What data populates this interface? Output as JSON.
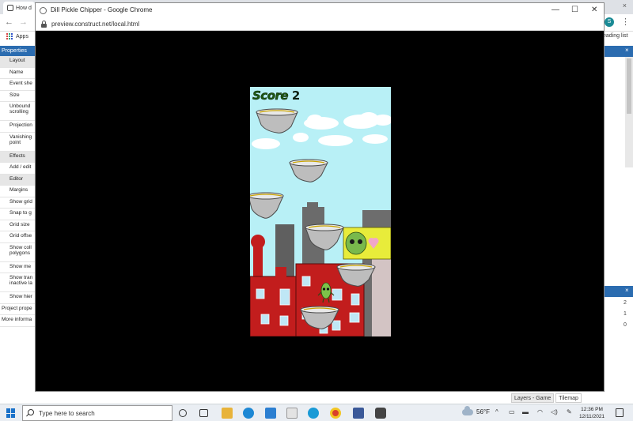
{
  "background_browser": {
    "tab_title": "How d",
    "apps_label": "Apps",
    "reading_list_label": "eading list",
    "profile_initial": "S"
  },
  "properties_panel": {
    "header": "Properties",
    "rows": [
      "Layout",
      "Name",
      "Event she",
      "Size",
      "Unbound scrolling",
      "Projection",
      "Vanishing point",
      "Effects",
      "Add / edit",
      "Editor",
      "Margins",
      "Show grid",
      "Snap to g",
      "Grid size",
      "Grid offse",
      "Show coll polygons",
      "Show me",
      "Show tran inactive la",
      "Show hier",
      "Project prope",
      "More informa"
    ]
  },
  "right_panel": {
    "numbers": [
      "2",
      "1",
      "0"
    ],
    "tabs": [
      "Layers - Game",
      "Tilemap"
    ]
  },
  "popup": {
    "title": "Dill Pickle Chipper - Google Chrome",
    "url": "preview.construct.net/local.html"
  },
  "game": {
    "score_label": "Score",
    "score_value": "2"
  },
  "taskbar": {
    "search_placeholder": "Type here to search",
    "weather_temp": "56°F",
    "time": "12:36 PM",
    "date": "12/11/2021"
  },
  "colors": {
    "sky": "#b8f0f6",
    "building_red": "#c21d1d",
    "properties_blue": "#2b6cb0",
    "popup_background": "#000000"
  }
}
